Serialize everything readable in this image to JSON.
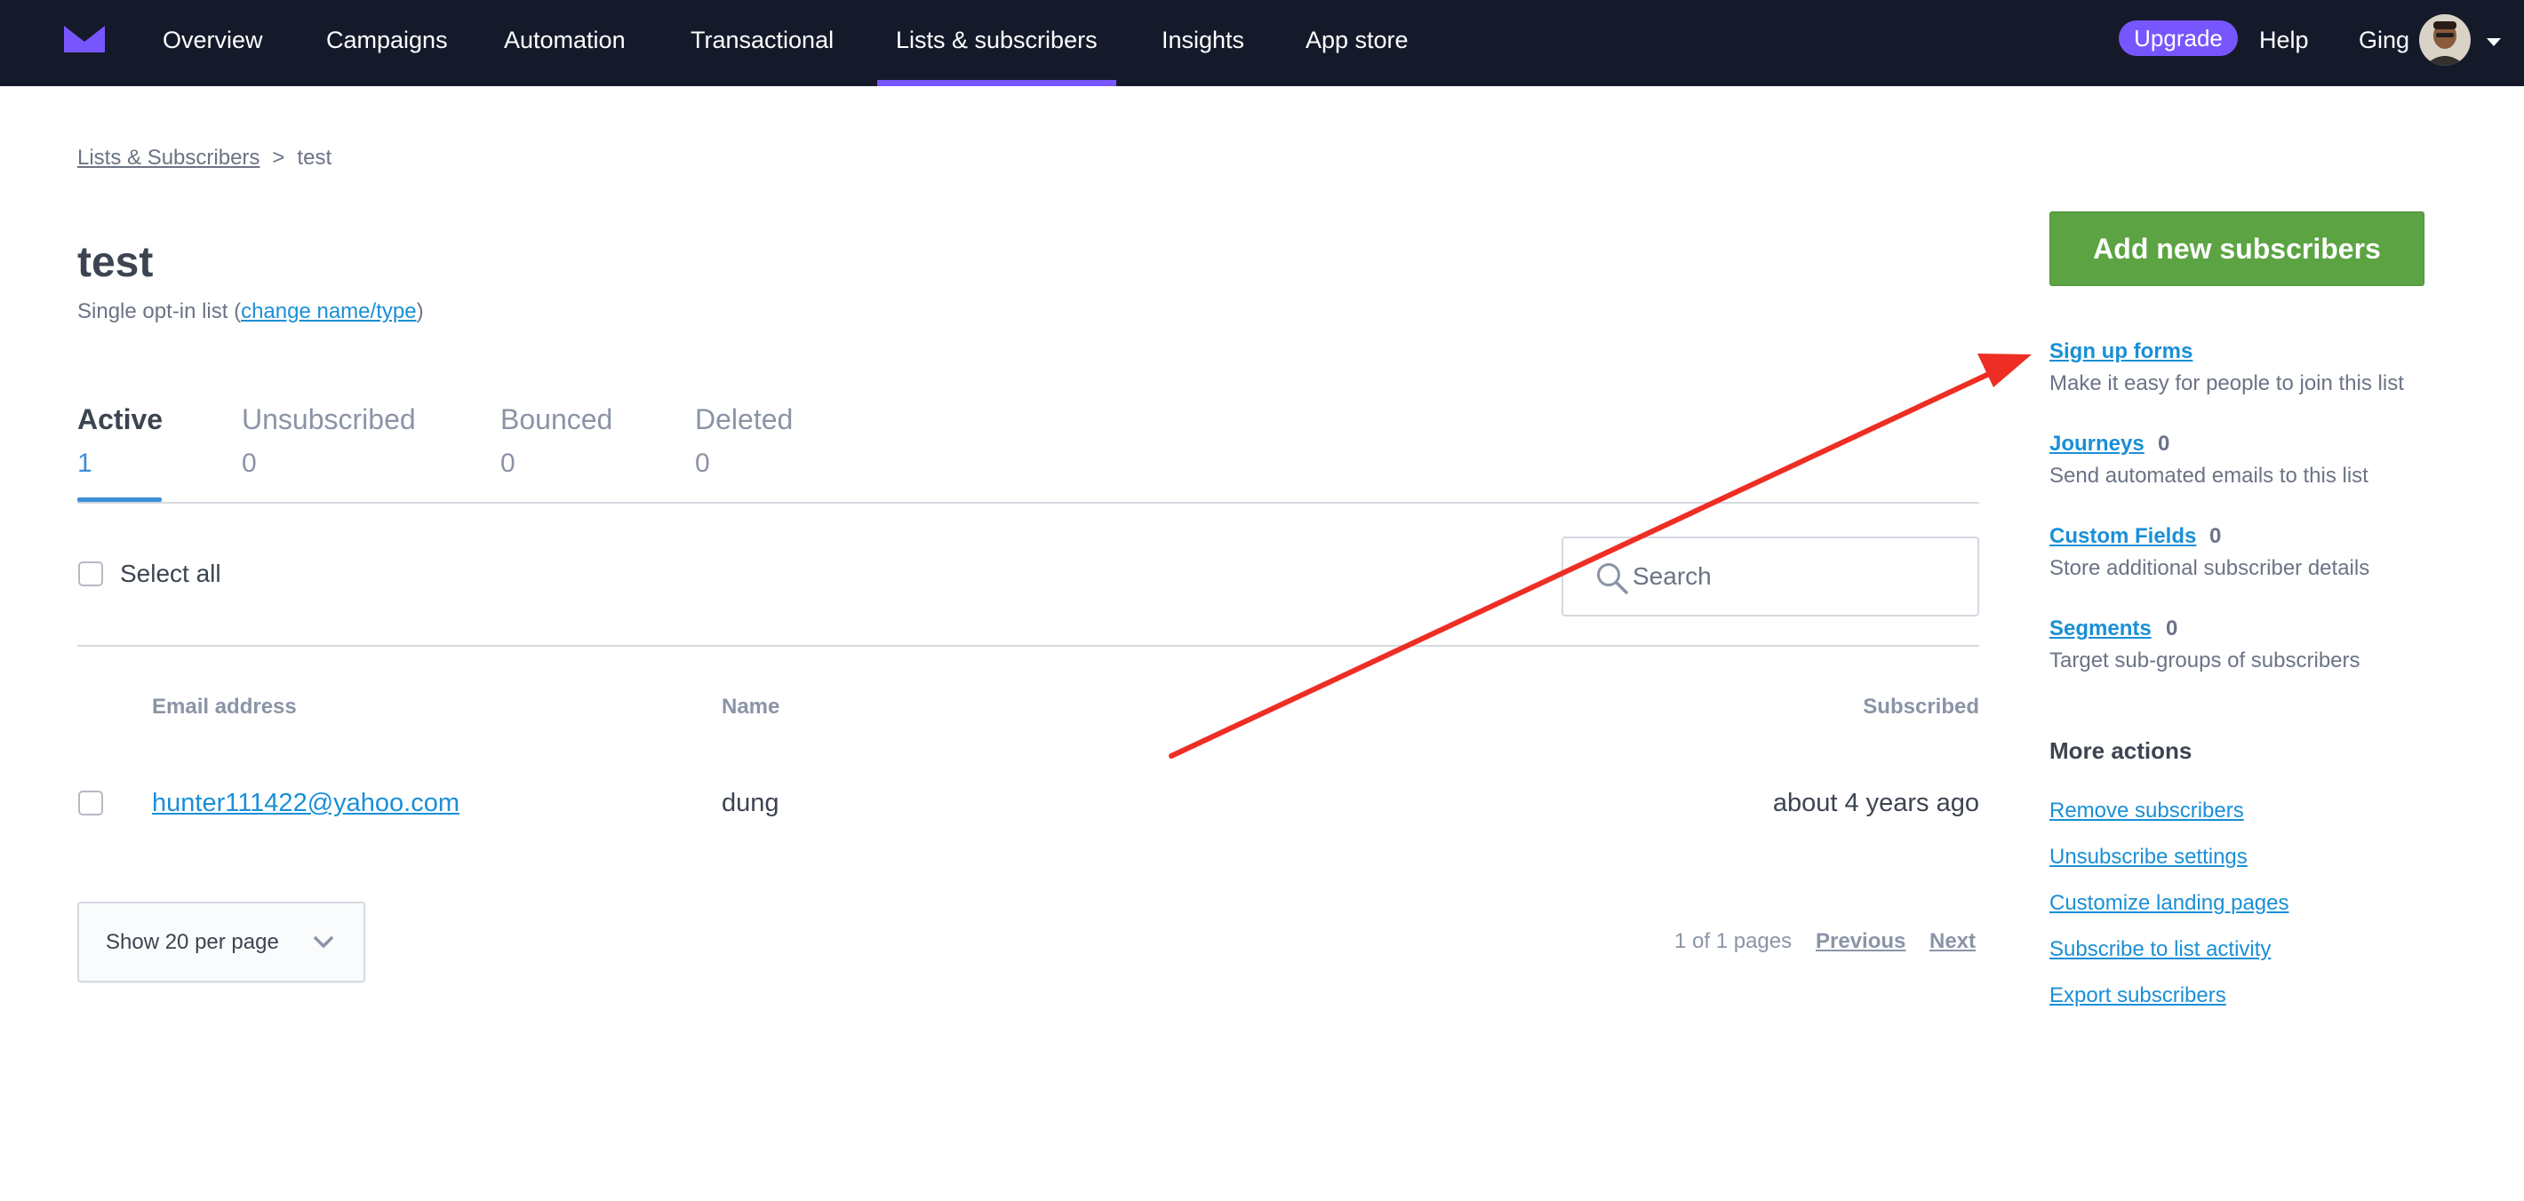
{
  "nav": {
    "items": [
      "Overview",
      "Campaigns",
      "Automation",
      "Transactional",
      "Lists & subscribers",
      "Insights",
      "App store"
    ],
    "active": "Lists & subscribers",
    "upgrade_label": "Upgrade",
    "help_label": "Help",
    "user_name": "Ging"
  },
  "breadcrumb": {
    "parent": "Lists & Subscribers",
    "separator": ">",
    "current": "test"
  },
  "list": {
    "title": "test",
    "type_prefix": "Single opt-in list (",
    "type_link": "change name/type",
    "type_suffix": ")"
  },
  "tabs": [
    {
      "label": "Active",
      "count": "1"
    },
    {
      "label": "Unsubscribed",
      "count": "0"
    },
    {
      "label": "Bounced",
      "count": "0"
    },
    {
      "label": "Deleted",
      "count": "0"
    }
  ],
  "toolbar": {
    "select_all_label": "Select all",
    "search_placeholder": "Search"
  },
  "table": {
    "columns": [
      "Email address",
      "Name",
      "Subscribed"
    ],
    "rows": [
      {
        "email": "hunter111422@yahoo.com",
        "name": "dung",
        "subscribed": "about 4 years ago"
      }
    ]
  },
  "footer": {
    "per_page_label": "Show 20 per page",
    "page_info": "1 of 1 pages",
    "previous_label": "Previous",
    "next_label": "Next"
  },
  "sidebar": {
    "add_button_label": "Add new subscribers",
    "sections": [
      {
        "link": "Sign up forms",
        "count": "",
        "description": "Make it easy for people to join this list"
      },
      {
        "link": "Journeys",
        "count": "0",
        "description": "Send automated emails to this list"
      },
      {
        "link": "Custom Fields",
        "count": "0",
        "description": "Store additional subscriber details"
      },
      {
        "link": "Segments",
        "count": "0",
        "description": "Target sub-groups of subscribers"
      }
    ],
    "more_actions_heading": "More actions",
    "more_actions": [
      "Remove subscribers",
      "Unsubscribe settings",
      "Customize landing pages",
      "Subscribe to list activity",
      "Export subscribers"
    ]
  },
  "colors": {
    "nav_background": "#151a2b",
    "nav_accent": "#7856ff",
    "link": "#1a8fd6",
    "primary_button": "#5ca443",
    "annotation_arrow": "#ee2e24"
  },
  "icons": {
    "logo": "campaign-monitor-logo",
    "search": "search-icon",
    "per_page_chevron": "chevron-down-icon",
    "user_menu": "caret-down-icon"
  }
}
